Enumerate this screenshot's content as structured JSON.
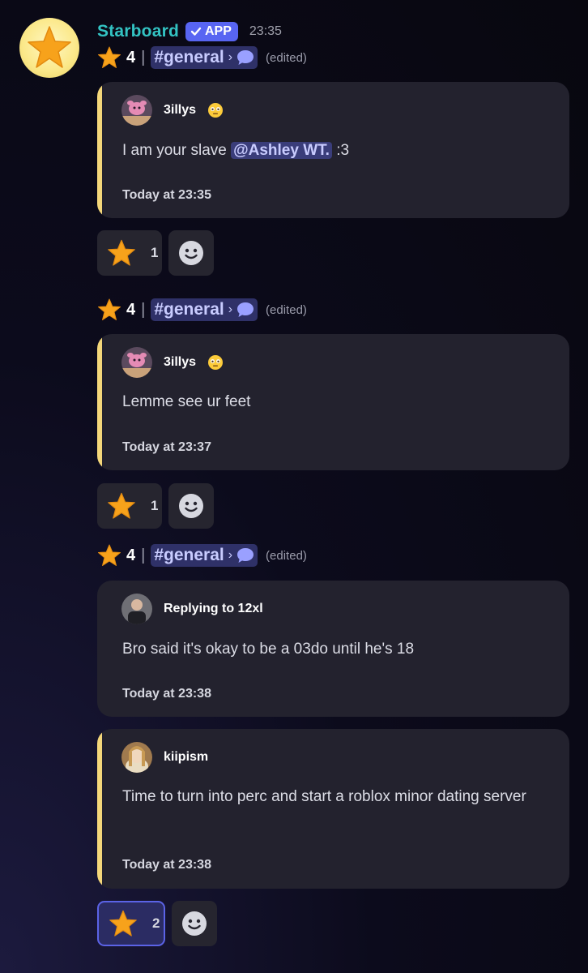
{
  "bot": {
    "username": "Starboard",
    "badge_label": "APP",
    "timestamp": "23:35"
  },
  "colors": {
    "star_bar": "#f4d77a",
    "mention_bg": "#3a3d7a",
    "badge_bg": "#5865f2",
    "username": "#33c3c3"
  },
  "entries": [
    {
      "star_icon": "star-icon",
      "count": "4",
      "channel": "#general",
      "edited": "(edited)",
      "embeds": [
        {
          "author": "3illys",
          "author_emoji": "flushed-emoji",
          "text_before": "I am your slave ",
          "mention": "@Ashley WT.",
          "text_after": " :3",
          "time": "Today at 23:35"
        }
      ],
      "reaction": {
        "count": "1"
      }
    },
    {
      "star_icon": "star-icon",
      "count": "4",
      "channel": "#general",
      "edited": "(edited)",
      "embeds": [
        {
          "author": "3illys",
          "author_emoji": "flushed-emoji",
          "text": "Lemme see ur feet",
          "time": "Today at 23:37"
        }
      ],
      "reaction": {
        "count": "1"
      }
    },
    {
      "star_icon": "star-icon",
      "count": "4",
      "channel": "#general",
      "edited": "(edited)",
      "embeds": [
        {
          "author": "Replying to 12xl",
          "text": "Bro said it's okay to be a 03do until he's 18",
          "time": "Today at 23:38"
        },
        {
          "author": "kiipism",
          "text": "Time to turn into perc and start a roblox minor dating server",
          "time": "Today at 23:38"
        }
      ],
      "reaction": {
        "count": "2"
      }
    }
  ]
}
